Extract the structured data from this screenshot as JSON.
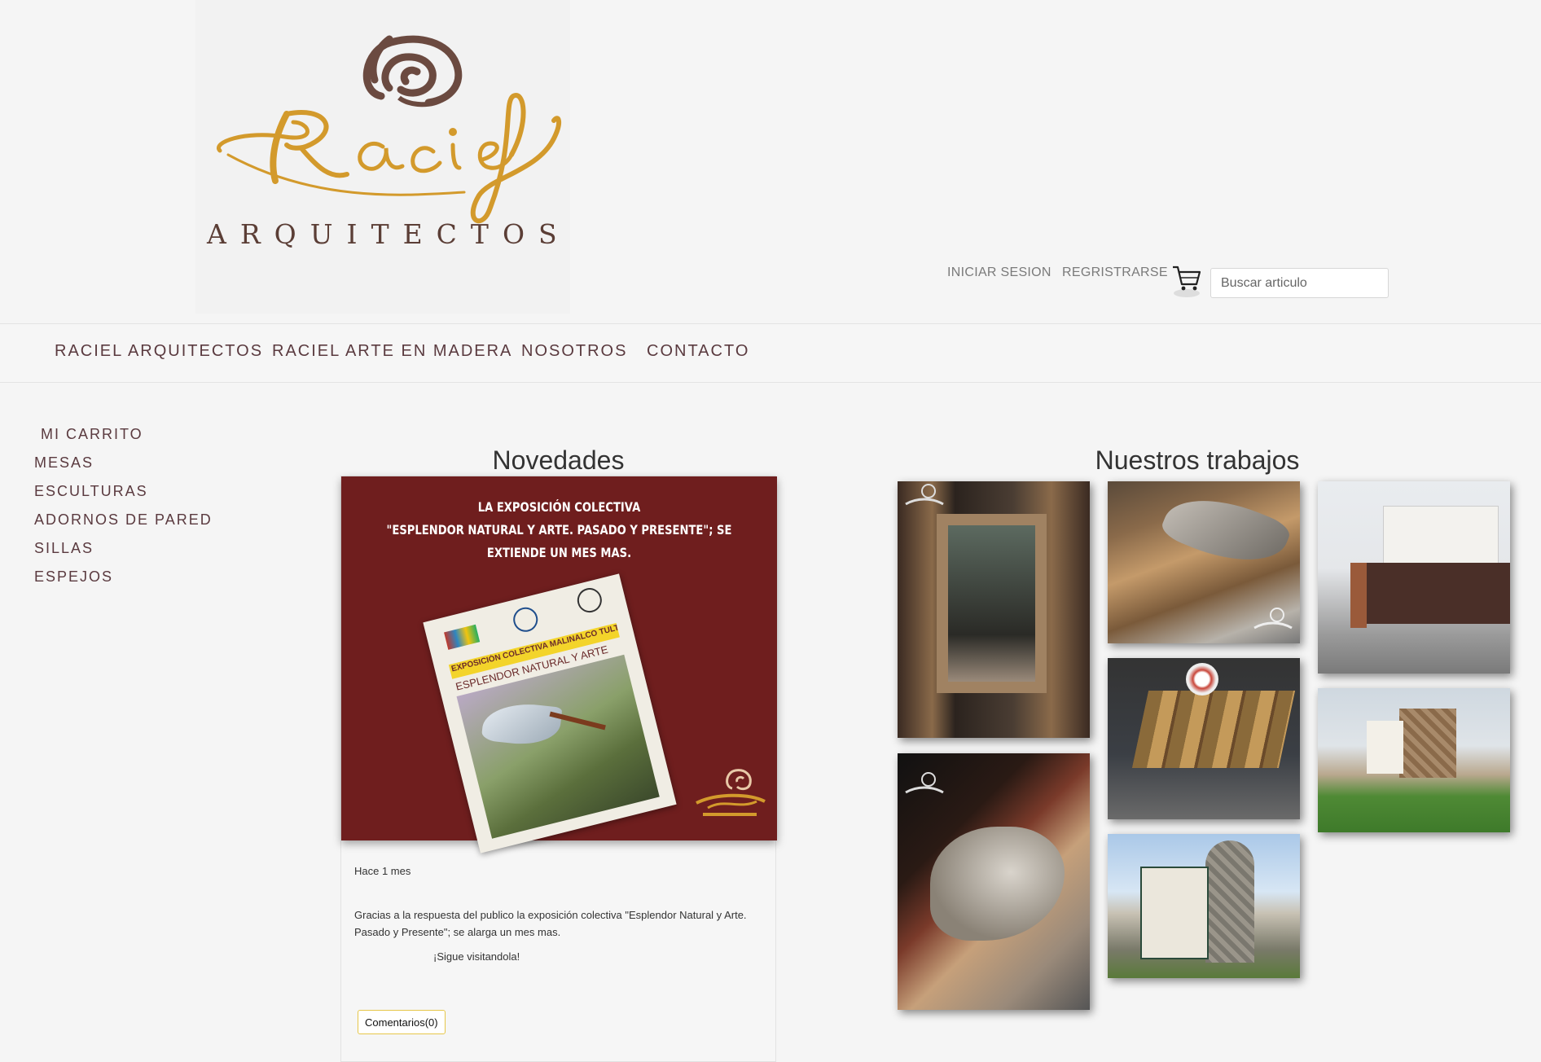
{
  "header": {
    "logo_word": "ARQUITECTOS",
    "login_label": "INICIAR SESION",
    "register_label": "REGRISTRARSE",
    "cart_icon": "shopping-cart-icon",
    "search_placeholder": "Buscar articulo"
  },
  "nav": {
    "items": [
      {
        "label": "RACIEL ARQUITECTOS"
      },
      {
        "label": "RACIEL ARTE EN MADERA"
      },
      {
        "label": "NOSOTROS"
      },
      {
        "label": "CONTACTO"
      }
    ]
  },
  "sidebar": {
    "items": [
      {
        "label": "MI CARRITO"
      },
      {
        "label": "MESAS"
      },
      {
        "label": "ESCULTURAS"
      },
      {
        "label": "ADORNOS DE PARED"
      },
      {
        "label": "SILLAS"
      },
      {
        "label": "ESPEJOS"
      }
    ]
  },
  "news": {
    "title": "Novedades",
    "headline_line1": "LA EXPOSICIÓN COLECTIVA",
    "headline_line2": "\"ESPLENDOR NATURAL Y ARTE. PASADO Y PRESENTE\"; SE EXTIENDE UN MES MAS.",
    "poster_line1": "EXPOSICIÓN COLECTIVA MALINALCO TULTEPEC",
    "poster_line2": "ESPLENDOR NATURAL Y ARTE",
    "time": "Hace 1 mes",
    "body": "Gracias a la respuesta del publico la exposición colectiva \"Esplendor Natural y Arte. Pasado y Presente\"; se alarga un mes mas.",
    "cta": "¡Sigue visitandola!",
    "comments_label": "Comentarios(0)"
  },
  "works": {
    "title": "Nuestros trabajos"
  },
  "colors": {
    "brand_gold": "#d39a2c",
    "brand_brown": "#5b3e36",
    "news_background": "#6f1e1e",
    "nav_text": "#5a3a3f"
  }
}
